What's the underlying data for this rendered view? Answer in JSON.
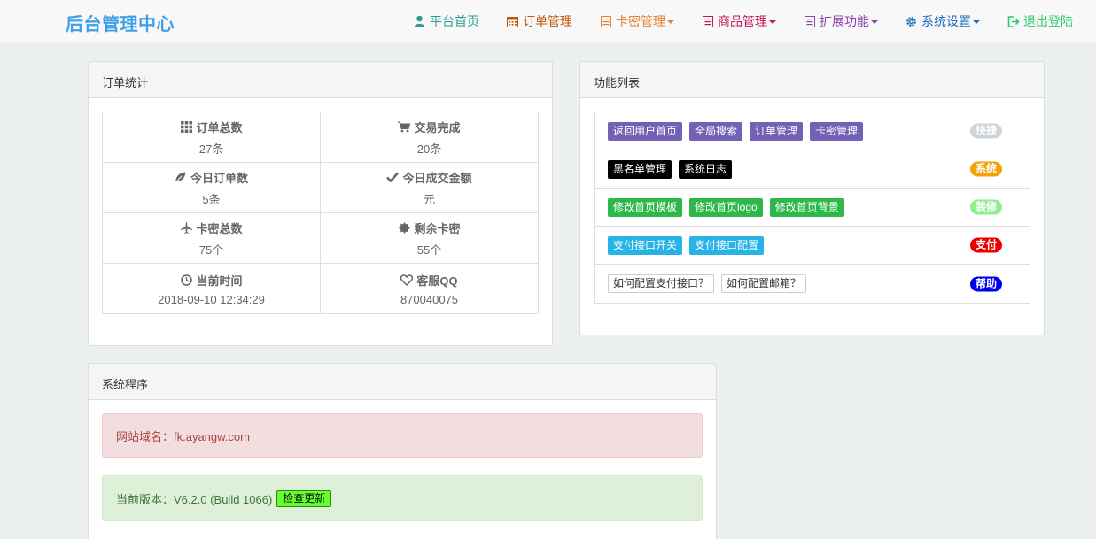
{
  "brand": "后台管理中心",
  "nav": [
    {
      "label": "平台首页",
      "icon": "user-icon",
      "color": "#2a9d8f",
      "dropdown": false
    },
    {
      "label": "订单管理",
      "icon": "calendar-icon",
      "color": "#c0580b",
      "dropdown": false
    },
    {
      "label": "卡密管理",
      "icon": "list-icon",
      "color": "#e9822c",
      "dropdown": true
    },
    {
      "label": "商品管理",
      "icon": "list-icon",
      "color": "#c2185b",
      "dropdown": true
    },
    {
      "label": "扩展功能",
      "icon": "list-icon",
      "color": "#8e44ad",
      "dropdown": true
    },
    {
      "label": "系统设置",
      "icon": "gear-icon",
      "color": "#1e6fc0",
      "dropdown": true
    },
    {
      "label": "退出登陆",
      "icon": "logout-icon",
      "color": "#2ecc71",
      "dropdown": false
    }
  ],
  "orders_panel": {
    "title": "订单统计",
    "stats": [
      {
        "label": "订单总数",
        "value": "27条",
        "icon": "grid-icon"
      },
      {
        "label": "交易完成",
        "value": "20条",
        "icon": "cart-icon"
      },
      {
        "label": "今日订单数",
        "value": "5条",
        "icon": "leaf-icon"
      },
      {
        "label": "今日成交金额",
        "value": "元",
        "icon": "check-icon"
      },
      {
        "label": "卡密总数",
        "value": "75个",
        "icon": "plane-icon"
      },
      {
        "label": "剩余卡密",
        "value": "55个",
        "icon": "certificate-icon"
      },
      {
        "label": "当前时间",
        "value": "2018-09-10 12:34:29",
        "icon": "clock-icon"
      },
      {
        "label": "客服QQ",
        "value": "870040075",
        "icon": "heart-icon"
      }
    ]
  },
  "funcs_panel": {
    "title": "功能列表",
    "rows": [
      {
        "badge": "快捷",
        "badge_color": "#cdd5dc",
        "btn_color": "#7361b5",
        "light": false,
        "buttons": [
          "返回用户首页",
          "全局搜索",
          "订单管理",
          "卡密管理"
        ]
      },
      {
        "badge": "系统",
        "badge_color": "#f0a30a",
        "btn_color": "#000000",
        "light": false,
        "buttons": [
          "黑名单管理",
          "系统日志"
        ]
      },
      {
        "badge": "装修",
        "badge_color": "#90ee90",
        "btn_color": "#2eb84b",
        "light": false,
        "buttons": [
          "修改首页模板",
          "修改首页logo",
          "修改首页背景"
        ]
      },
      {
        "badge": "支付",
        "badge_color": "#ee0000",
        "btn_color": "#27b3e6",
        "light": false,
        "buttons": [
          "支付接口开关",
          "支付接口配置"
        ]
      },
      {
        "badge": "帮助",
        "badge_color": "#0000ee",
        "btn_color": "#ffffff",
        "light": true,
        "buttons": [
          "如何配置支付接口？",
          "如何配置邮箱？"
        ]
      }
    ]
  },
  "system_panel": {
    "title": "系统程序",
    "domain_label": "网站域名：fk.ayangw.com",
    "version_label": "当前版本：V6.2.0 (Build 1066)",
    "check_update": "检查更新"
  }
}
